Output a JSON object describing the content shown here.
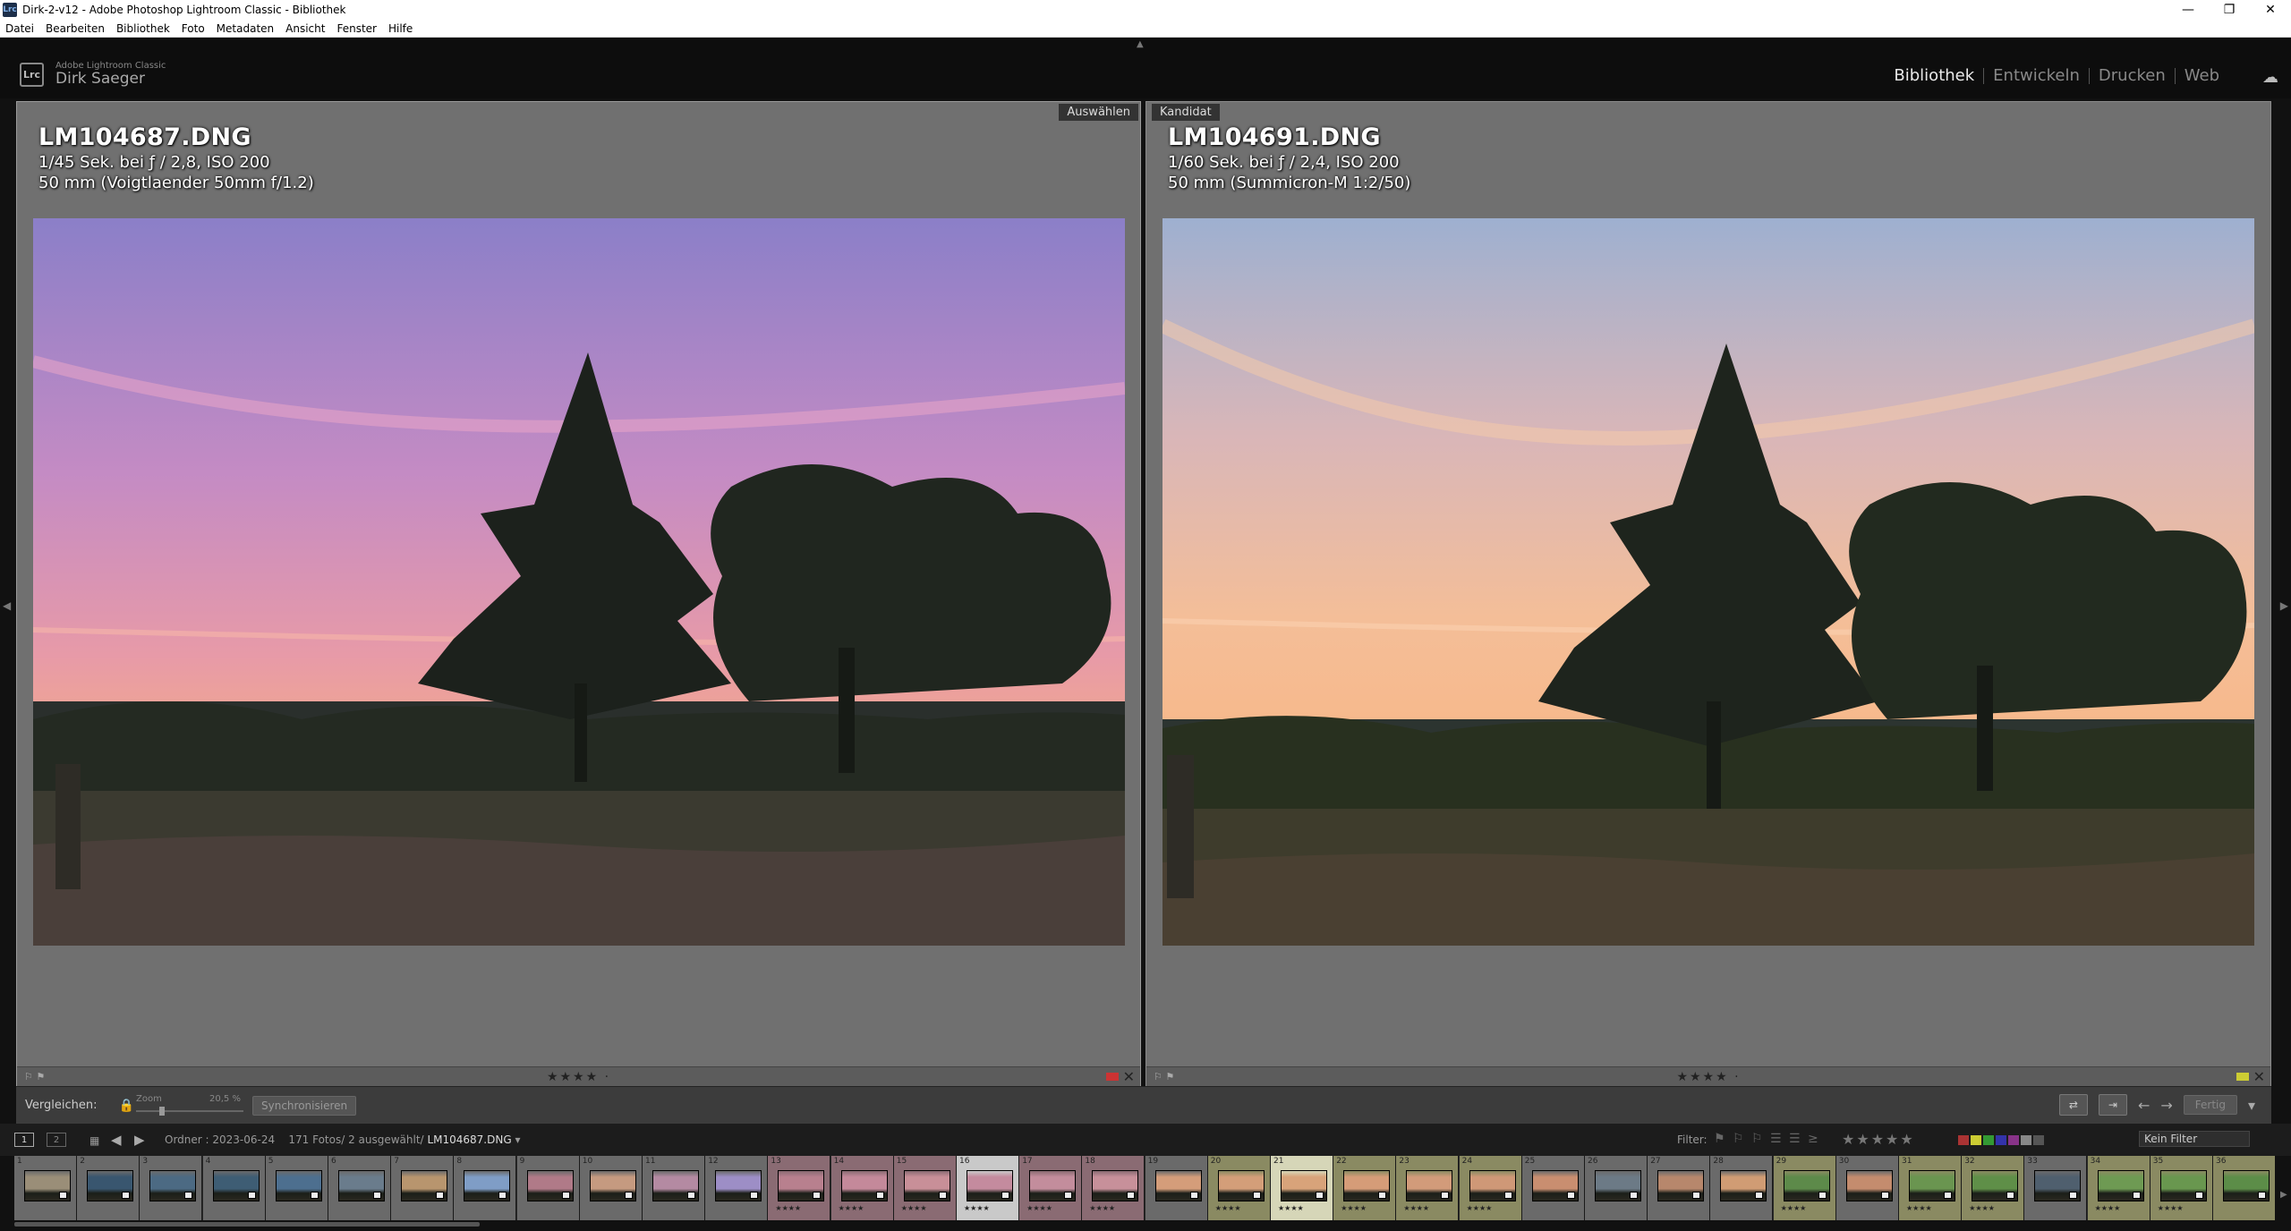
{
  "window": {
    "title": "Dirk-2-v12 - Adobe Photoshop Lightroom Classic - Bibliothek",
    "app_icon_text": "Lrc",
    "controls": [
      "—",
      "❐",
      "✕"
    ]
  },
  "menu": [
    "Datei",
    "Bearbeiten",
    "Bibliothek",
    "Foto",
    "Metadaten",
    "Ansicht",
    "Fenster",
    "Hilfe"
  ],
  "identity": {
    "logo": "Lrc",
    "product": "Adobe Lightroom Classic",
    "user": "Dirk Saeger"
  },
  "modules": [
    {
      "label": "Bibliothek",
      "active": true
    },
    {
      "label": "Entwickeln",
      "active": false
    },
    {
      "label": "Drucken",
      "active": false
    },
    {
      "label": "Web",
      "active": false
    }
  ],
  "compare": {
    "select": {
      "tag": "Auswählen",
      "filename": "LM104687.DNG",
      "exposure": "1/45 Sek. bei ƒ / 2,8, ISO 200",
      "lens": "50 mm (Voigtlaender 50mm f/1.2)",
      "stars": "★★★★ ·",
      "flags": "⚐ ⚑"
    },
    "candidate": {
      "tag": "Kandidat",
      "filename": "LM104691.DNG",
      "exposure": "1/60 Sek. bei ƒ / 2,4, ISO 200",
      "lens": "50 mm (Summicron-M 1:2/50)",
      "stars": "★★★★ ·",
      "flags": "⚐ ⚑"
    }
  },
  "toolbar": {
    "compare_label": "Vergleichen:",
    "zoom_label": "Zoom",
    "zoom_value": "20,5 %",
    "sync_label": "Synchronisieren",
    "done_label": "Fertig",
    "prev_arrow": "←",
    "next_arrow": "→",
    "dropdown": "▾"
  },
  "filmstrip_header": {
    "screen1": "1",
    "screen2": "2",
    "grid_icon": "▦",
    "back": "◀",
    "forward": "▶",
    "folder_path": "Ordner : 2023-06-24",
    "count": "171 Fotos/ 2 ausgewählt/",
    "current_file": "LM104687.DNG",
    "dropdown_arrow": "▾",
    "filter_label": "Filter:",
    "filter_flags": "⚑ ⚐ ⚐   ☰ ☰   ≥",
    "filter_stars": "★★★★★",
    "filter_colors": [
      "#a33",
      "#cc3",
      "#393",
      "#33a",
      "#838",
      "#888",
      "#555"
    ],
    "filter_select": "Kein Filter"
  },
  "filmstrip": {
    "thumbs": [
      {
        "num": "1",
        "tone": "#9a8e78",
        "bg": "#6a6a6a",
        "stars": ""
      },
      {
        "num": "2",
        "tone": "#39566f",
        "bg": "#6a6a6a",
        "stars": ""
      },
      {
        "num": "3",
        "tone": "#4c6a83",
        "bg": "#6a6a6a",
        "stars": ""
      },
      {
        "num": "4",
        "tone": "#3e5d74",
        "bg": "#6a6a6a",
        "stars": ""
      },
      {
        "num": "5",
        "tone": "#4d6f8f",
        "bg": "#6a6a6a",
        "stars": ""
      },
      {
        "num": "6",
        "tone": "#6a7c8c",
        "bg": "#6a6a6a",
        "stars": ""
      },
      {
        "num": "7",
        "tone": "#b8956e",
        "bg": "#6a6a6a",
        "stars": ""
      },
      {
        "num": "8",
        "tone": "#7f9dc6",
        "bg": "#6a6a6a",
        "stars": ""
      },
      {
        "num": "9",
        "tone": "#b07a88",
        "bg": "#6a6a6a",
        "stars": ""
      },
      {
        "num": "10",
        "tone": "#c59a80",
        "bg": "#6a6a6a",
        "stars": ""
      },
      {
        "num": "11",
        "tone": "#b48aa2",
        "bg": "#6a6a6a",
        "stars": ""
      },
      {
        "num": "12",
        "tone": "#9d8ec6",
        "bg": "#6a6a6a",
        "stars": ""
      },
      {
        "num": "13",
        "tone": "#b8808e",
        "bg": "#8a6b73",
        "stars": "★★★★"
      },
      {
        "num": "14",
        "tone": "#c4899a",
        "bg": "#8a6b73",
        "stars": "★★★★"
      },
      {
        "num": "15",
        "tone": "#c88f98",
        "bg": "#8a6b73",
        "stars": "★★★★"
      },
      {
        "num": "16",
        "tone": "#c48b9e",
        "bg": "#c9c9c9",
        "stars": "★★★★"
      },
      {
        "num": "17",
        "tone": "#c38d9c",
        "bg": "#8a6b73",
        "stars": "★★★★"
      },
      {
        "num": "18",
        "tone": "#c7909a",
        "bg": "#8a6b73",
        "stars": "★★★★"
      },
      {
        "num": "19",
        "tone": "#d49d7a",
        "bg": "#6a6a6a",
        "stars": ""
      },
      {
        "num": "20",
        "tone": "#d39e79",
        "bg": "#8a8a62",
        "stars": "★★★★"
      },
      {
        "num": "21",
        "tone": "#d8a37a",
        "bg": "#d6d6b8",
        "stars": "★★★★"
      },
      {
        "num": "22",
        "tone": "#d59c78",
        "bg": "#8a8a62",
        "stars": "★★★★"
      },
      {
        "num": "23",
        "tone": "#d29b7a",
        "bg": "#8a8a62",
        "stars": "★★★★"
      },
      {
        "num": "24",
        "tone": "#cf9877",
        "bg": "#8a8a62",
        "stars": "★★★★"
      },
      {
        "num": "25",
        "tone": "#c98e70",
        "bg": "#6a6a6a",
        "stars": ""
      },
      {
        "num": "26",
        "tone": "#6c7a86",
        "bg": "#6a6a6a",
        "stars": ""
      },
      {
        "num": "27",
        "tone": "#b7876c",
        "bg": "#6a6a6a",
        "stars": ""
      },
      {
        "num": "28",
        "tone": "#d09c74",
        "bg": "#6a6a6a",
        "stars": ""
      },
      {
        "num": "29",
        "tone": "#5d8a4a",
        "bg": "#8a8a62",
        "stars": "★★★★"
      },
      {
        "num": "30",
        "tone": "#c48c6e",
        "bg": "#6a6a6a",
        "stars": ""
      },
      {
        "num": "31",
        "tone": "#6a9550",
        "bg": "#8a8a62",
        "stars": "★★★★"
      },
      {
        "num": "32",
        "tone": "#5f8f48",
        "bg": "#8a8a62",
        "stars": "★★★★"
      },
      {
        "num": "33",
        "tone": "#4f5f6e",
        "bg": "#6a6a6a",
        "stars": ""
      },
      {
        "num": "34",
        "tone": "#6e9a53",
        "bg": "#8a8a62",
        "stars": "★★★★"
      },
      {
        "num": "35",
        "tone": "#69974f",
        "bg": "#8a8a62",
        "stars": "★★★★"
      },
      {
        "num": "36",
        "tone": "#5c8d48",
        "bg": "#8a8a62",
        "stars": ""
      }
    ]
  }
}
